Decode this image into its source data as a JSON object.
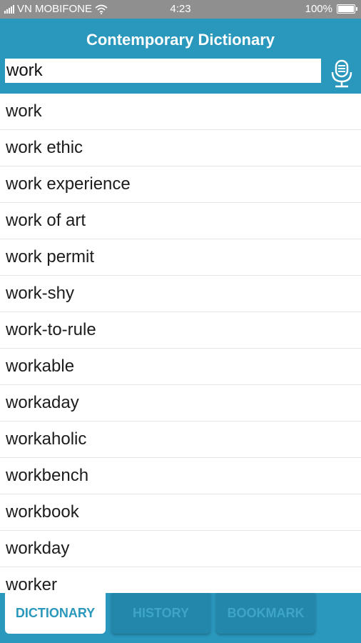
{
  "status_bar": {
    "carrier": "VN MOBIFONE",
    "time": "4:23",
    "battery": "100%",
    "icons": [
      "signal-icon",
      "wifi-icon",
      "battery-icon"
    ]
  },
  "header": {
    "title": "Contemporary Dictionary",
    "search_value": "work",
    "mic_icon": "microphone-icon"
  },
  "results": [
    "work",
    "work ethic",
    "work experience",
    "work of art",
    "work permit",
    "work-shy",
    "work-to-rule",
    "workable",
    "workaday",
    "workaholic",
    "workbench",
    "workbook",
    "workday",
    "worker"
  ],
  "tabs": {
    "dictionary": "DICTIONARY",
    "history": "HISTORY",
    "bookmark": "BOOKMARK",
    "active": "dictionary"
  },
  "colors": {
    "primary": "#2a97bc",
    "status_bar": "#8f8f8f"
  }
}
